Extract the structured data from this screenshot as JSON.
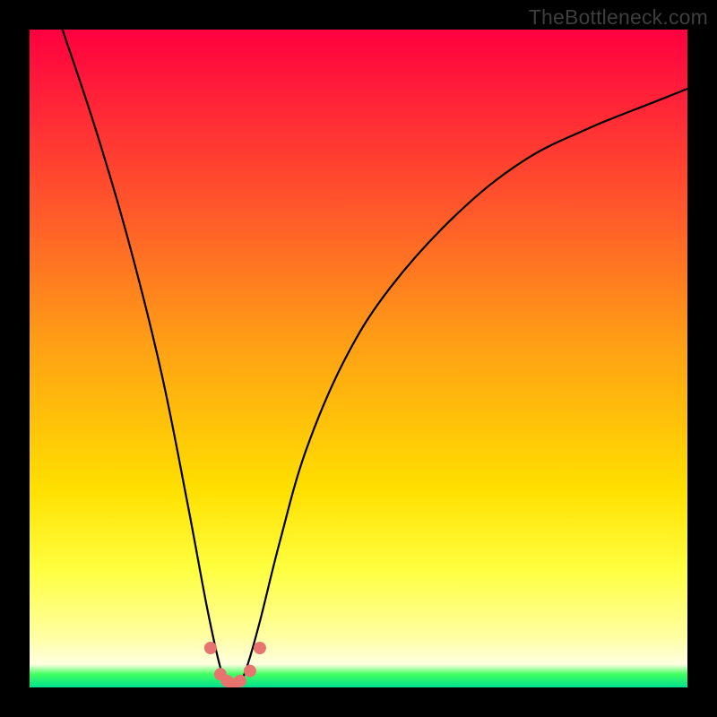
{
  "watermark": "TheBottleneck.com",
  "chart_data": {
    "type": "line",
    "title": "",
    "xlabel": "",
    "ylabel": "",
    "ylim": [
      0,
      100
    ],
    "xlim": [
      0,
      100
    ],
    "series": [
      {
        "name": "bottleneck-curve",
        "x": [
          5,
          10,
          15,
          20,
          24,
          27,
          29,
          30,
          31,
          32,
          33,
          35,
          38,
          42,
          48,
          55,
          65,
          75,
          85,
          95,
          100
        ],
        "values": [
          100,
          85,
          68,
          48,
          28,
          12,
          3,
          1,
          0.5,
          1,
          3,
          10,
          22,
          36,
          50,
          61,
          72,
          80,
          85,
          89,
          91
        ]
      }
    ],
    "markers": {
      "name": "min-region",
      "color": "#e8746f",
      "x": [
        27.5,
        29,
        30,
        31,
        32,
        33.5,
        35
      ],
      "values": [
        6,
        2,
        1,
        0.5,
        1,
        2.5,
        6
      ]
    },
    "gradient_stops": [
      {
        "pos": 0.0,
        "color": "#ff0040"
      },
      {
        "pos": 0.7,
        "color": "#ffe000"
      },
      {
        "pos": 0.95,
        "color": "#ffffc0"
      },
      {
        "pos": 1.0,
        "color": "#00e090"
      }
    ]
  }
}
